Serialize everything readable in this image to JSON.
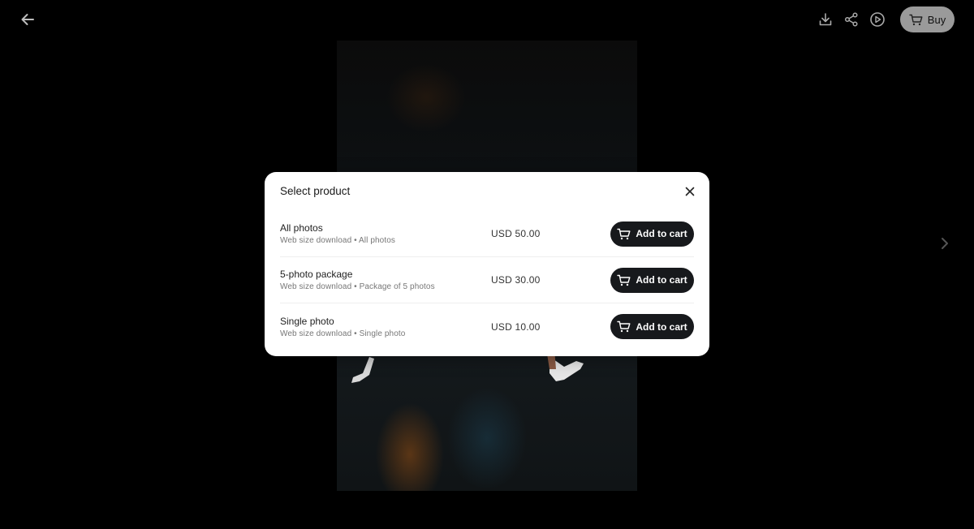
{
  "topbar": {
    "back_icon": "arrow-left-icon",
    "actions": [
      "download-icon",
      "share-icon",
      "play-circle-icon"
    ],
    "buy_label": "Buy"
  },
  "colors": {
    "background": "#000000",
    "modal_bg": "#ffffff",
    "button_dark": "#17191c",
    "buy_button": "#9a9a9a"
  },
  "modal": {
    "title": "Select product",
    "products": [
      {
        "name": "All photos",
        "description": "Web size download • All photos",
        "price": "USD 50.00",
        "button_label": "Add to cart"
      },
      {
        "name": "5-photo package",
        "description": "Web size download • Package of 5 photos",
        "price": "USD 30.00",
        "button_label": "Add to cart"
      },
      {
        "name": "Single photo",
        "description": "Web size download • Single photo",
        "price": "USD 10.00",
        "button_label": "Add to cart"
      }
    ]
  }
}
